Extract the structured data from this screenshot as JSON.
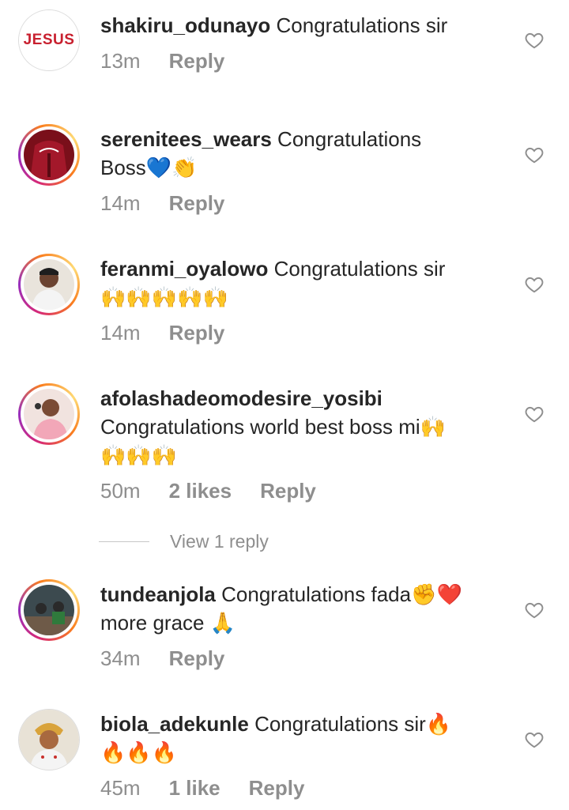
{
  "comments": [
    {
      "username": "shakiru_odunayo",
      "text": " Congratulations sir",
      "time": "13m",
      "likes": "",
      "reply": "Reply",
      "avatar": "JESUS"
    },
    {
      "username": "serenitees_wears",
      "text": " Congratulations Boss💙👏",
      "time": "14m",
      "likes": "",
      "reply": "Reply"
    },
    {
      "username": "feranmi_oyalowo",
      "text": " Congratulations sir 🙌🙌🙌🙌🙌",
      "time": "14m",
      "likes": "",
      "reply": "Reply"
    },
    {
      "username": "afolashadeomodesire_yosibi",
      "text": " Congratulations world best boss mi🙌🙌🙌🙌",
      "time": "50m",
      "likes": "2 likes",
      "reply": "Reply"
    },
    {
      "username": "tundeanjola",
      "text": " Congratulations fada✊❤️more grace 🙏",
      "time": "34m",
      "likes": "",
      "reply": "Reply"
    },
    {
      "username": "biola_adekunle",
      "text": " Congratulations sir🔥🔥🔥🔥",
      "time": "45m",
      "likes": "1 like",
      "reply": "Reply"
    }
  ],
  "view_replies": "View 1 reply",
  "icons": {
    "like": "heart-outline-icon"
  },
  "colors": {
    "text": "#262626",
    "muted": "#8e8e8e",
    "ring": "#d62976"
  }
}
